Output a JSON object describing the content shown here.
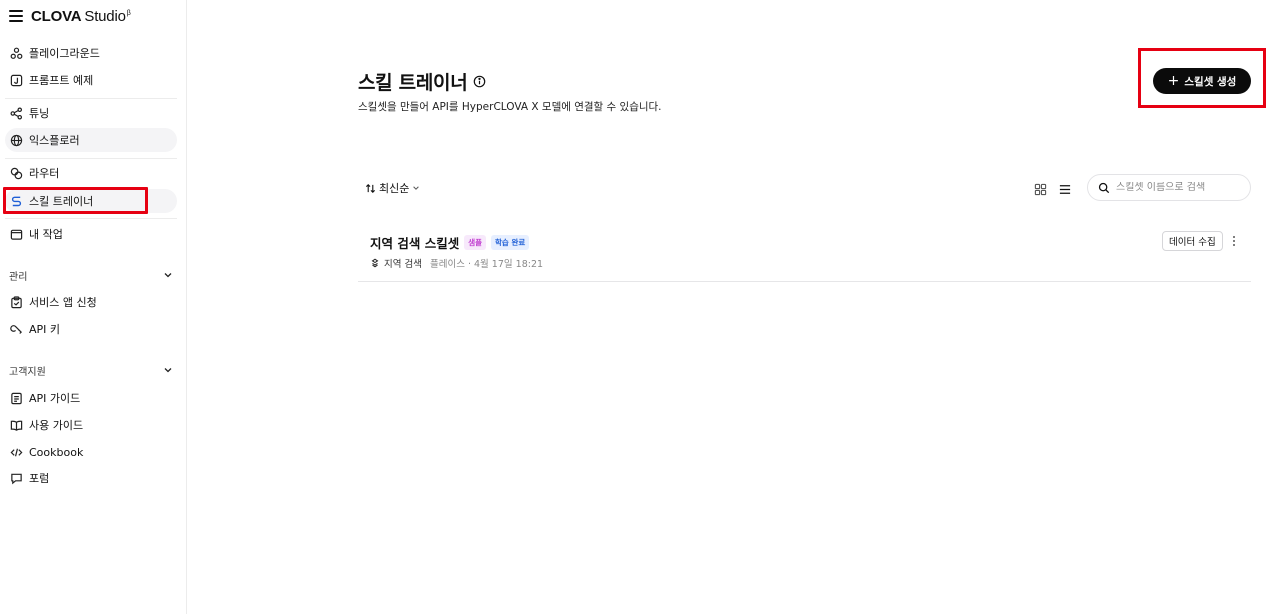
{
  "brand": {
    "name_bold": "CLOVA",
    "name_rest": "Studio",
    "sup": "β"
  },
  "sidebar": {
    "items": [
      {
        "label": "플레이그라운드",
        "icon": "playground-icon"
      },
      {
        "label": "프롬프트 예제",
        "icon": "prompt-example-icon"
      },
      {
        "label": "튜닝",
        "icon": "tuning-icon"
      },
      {
        "label": "익스플로러",
        "icon": "globe-icon"
      },
      {
        "label": "라우터",
        "icon": "router-icon"
      },
      {
        "label": "스킬 트레이너",
        "icon": "skill-trainer-icon"
      },
      {
        "label": "내 작업",
        "icon": "folder-icon"
      }
    ],
    "sections": [
      {
        "title": "관리",
        "items": [
          {
            "label": "서비스 앱 신청",
            "icon": "clipboard-icon"
          },
          {
            "label": "API 키",
            "icon": "key-icon"
          }
        ]
      },
      {
        "title": "고객지원",
        "items": [
          {
            "label": "API 가이드",
            "icon": "document-icon"
          },
          {
            "label": "사용 가이드",
            "icon": "book-icon"
          },
          {
            "label": "Cookbook",
            "icon": "code-icon"
          },
          {
            "label": "포럼",
            "icon": "chat-icon"
          }
        ]
      }
    ]
  },
  "main": {
    "title": "스킬 트레이너",
    "subtitle": "스킬셋을 만들어 API를 HyperCLOVA X 모델에 연결할 수 있습니다.",
    "create_button": "스킬셋 생성",
    "sort_label": "최신순",
    "search_placeholder": "스킬셋 이름으로 검색",
    "rows": [
      {
        "name": "지역 검색 스킬셋",
        "badge_sample": "샘플",
        "badge_status": "학습 완료",
        "skill": "지역 검색",
        "meta": "플레이스 · 4월 17일 18:21",
        "action": "데이터 수집"
      }
    ]
  },
  "colors": {
    "accent": "#0b0b0b",
    "highlight": "#e60012",
    "sample_badge": "#c13fd0",
    "status_badge": "#1f5fd6"
  }
}
